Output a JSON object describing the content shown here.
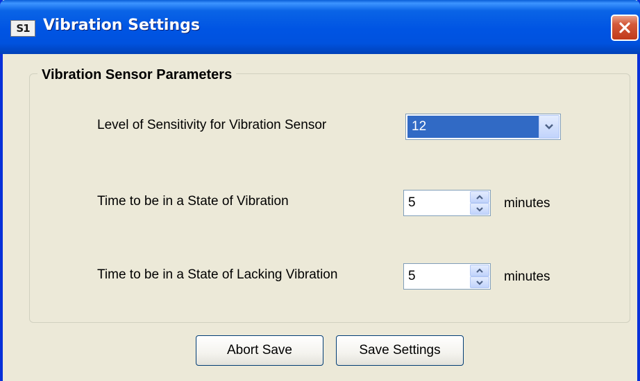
{
  "window": {
    "title": "Vibration Settings",
    "icon_text": "S1",
    "close_icon": "close-x"
  },
  "group": {
    "legend": "Vibration Sensor Parameters"
  },
  "fields": {
    "sensitivity": {
      "label": "Level of Sensitivity for Vibration Sensor",
      "value": "12",
      "control": "dropdown"
    },
    "vibration_time": {
      "label": "Time to be in a State of Vibration",
      "value": "5",
      "unit": "minutes",
      "control": "spinner"
    },
    "lacking_time": {
      "label": "Time to be in a State of Lacking Vibration",
      "value": "5",
      "unit": "minutes",
      "control": "spinner"
    }
  },
  "buttons": {
    "abort": "Abort Save",
    "save": "Save Settings"
  },
  "colors": {
    "titlebar": "#0054e3",
    "selection": "#316ac5",
    "close_button": "#c03a1a",
    "dialog_bg": "#ece9d8"
  }
}
